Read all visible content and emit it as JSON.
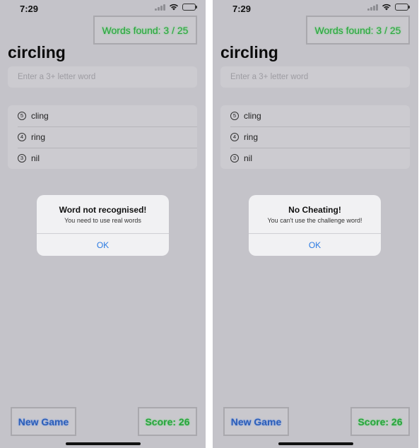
{
  "screens": [
    {
      "status": {
        "time": "7:29"
      },
      "words_found": "Words found: 3 / 25",
      "root_word": "circling",
      "input": {
        "placeholder": "Enter a 3+ letter word",
        "value": ""
      },
      "words": [
        {
          "count": "5",
          "word": "cling"
        },
        {
          "count": "4",
          "word": "ring"
        },
        {
          "count": "3",
          "word": "nil"
        }
      ],
      "alert": {
        "title": "Word not recognised!",
        "message": "You need to use real words",
        "button": "OK"
      },
      "new_game_label": "New Game",
      "score": "Score: 26"
    },
    {
      "status": {
        "time": "7:29"
      },
      "words_found": "Words found: 3 / 25",
      "root_word": "circling",
      "input": {
        "placeholder": "Enter a 3+ letter word",
        "value": ""
      },
      "words": [
        {
          "count": "5",
          "word": "cling"
        },
        {
          "count": "4",
          "word": "ring"
        },
        {
          "count": "3",
          "word": "nil"
        }
      ],
      "alert": {
        "title": "No Cheating!",
        "message": "You can't use the challenge word!",
        "button": "OK"
      },
      "new_game_label": "New Game",
      "score": "Score: 26"
    }
  ],
  "icons": [
    "signal-icon",
    "wifi-icon",
    "battery-icon"
  ],
  "colors": {
    "green_text": "#2aa43e",
    "blue_text": "#2d5fb8",
    "link_blue": "#2a7ae2",
    "backdrop": "#c4c3c9"
  }
}
